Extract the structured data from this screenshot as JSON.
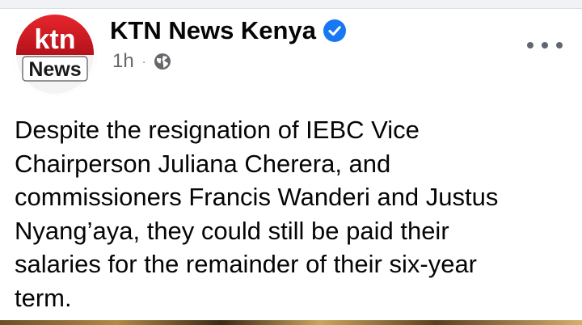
{
  "post": {
    "page_name": "KTN News Kenya",
    "time_ago": "1h",
    "separator": "·",
    "audience_icon": "globe-icon",
    "verified_icon": "verified-badge-icon",
    "more_icon": "more-options-icon",
    "avatar": {
      "logo_top": "ktn",
      "logo_bottom": "News"
    },
    "text": "Despite the resignation of IEBC Vice\nChairperson Juliana Cherera, and\ncommissioners Francis Wanderi and Justus\nNyang’aya, they could still be paid their\nsalaries for the remainder of their six-year\nterm."
  },
  "colors": {
    "verified_blue": "#1877f2",
    "ktn_red": "#d71920",
    "meta_gray": "#65676b"
  }
}
